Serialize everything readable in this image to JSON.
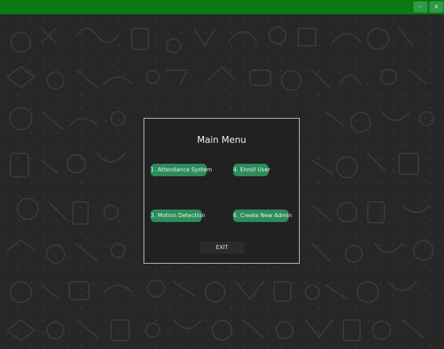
{
  "window": {
    "minimize_label": "-",
    "close_label": "x"
  },
  "main_menu": {
    "title": "Main Menu",
    "buttons": [
      {
        "label": "1. Attendance System"
      },
      {
        "label": "4. Enroll User"
      },
      {
        "label": "3. Motion Detection"
      },
      {
        "label": "6. Create New Admin"
      }
    ],
    "exit_label": "EXIT"
  },
  "colors": {
    "titlebar": "#0b7a12",
    "button": "#2e8c5a",
    "background": "#262626"
  }
}
